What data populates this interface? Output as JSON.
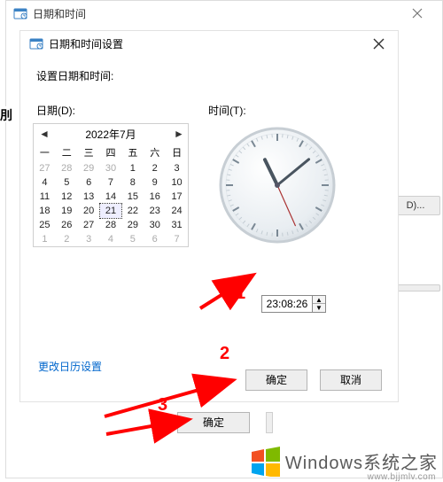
{
  "outer": {
    "title": "日期和时间",
    "right_hint": "D)..."
  },
  "dialog": {
    "title": "日期和时间设置",
    "prompt": "设置日期和时间:",
    "date_label": "日期(D):",
    "time_label": "时间(T):",
    "calendar": {
      "header": "2022年7月",
      "dow": [
        "一",
        "二",
        "三",
        "四",
        "五",
        "六",
        "日"
      ],
      "leading_faded": [
        27,
        28,
        29,
        30
      ],
      "days": [
        1,
        2,
        3,
        4,
        5,
        6,
        7,
        8,
        9,
        10,
        11,
        12,
        13,
        14,
        15,
        16,
        17,
        18,
        19,
        20,
        21,
        22,
        23,
        24,
        25,
        26,
        27,
        28,
        29,
        30,
        31
      ],
      "trailing_faded": [
        1,
        2,
        3,
        4,
        5,
        6,
        7
      ],
      "selected": 21
    },
    "time_value": "23:08:26",
    "link": "更改日历设置",
    "ok": "确定",
    "cancel": "取消"
  },
  "outer_ok": "确定",
  "left_stub": "刖",
  "annotations": {
    "n1": "1",
    "n2": "2",
    "n3": "3"
  },
  "watermark": {
    "big": "Windows系统之家",
    "sub": "www.bjjmlv.com"
  },
  "clock": {
    "hour": 23,
    "minute": 8,
    "second": 26
  }
}
